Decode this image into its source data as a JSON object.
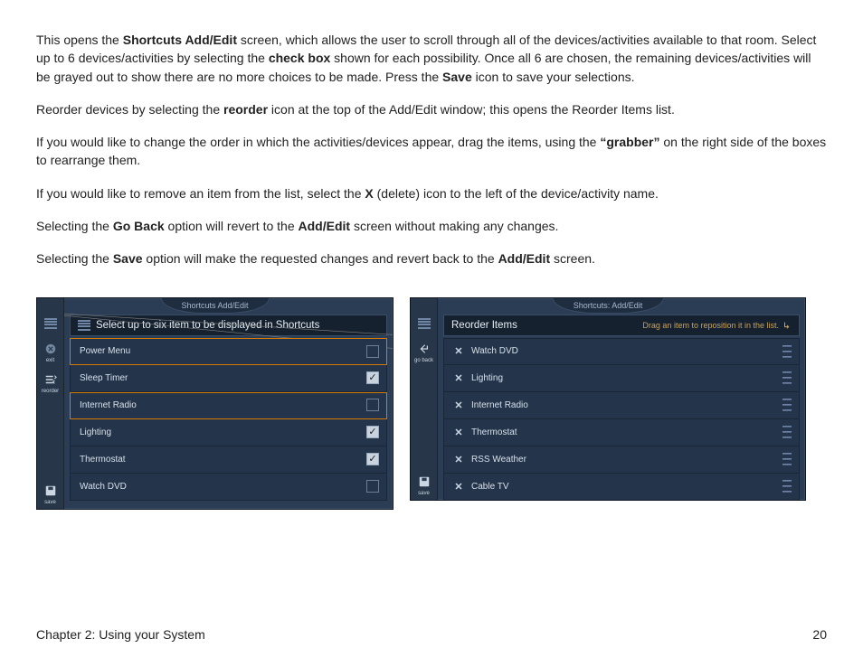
{
  "paragraphs": {
    "p1a": "This opens the ",
    "p1b": "Shortcuts Add/Edit",
    "p1c": " screen, which allows the user to scroll through all of the devices/activities available to that room. Select up to 6 devices/activities by selecting the ",
    "p1d": "check box",
    "p1e": " shown for each possibility. Once all 6 are chosen, the remaining devices/activities will be grayed out to show there are no more choices to be made. Press the ",
    "p1f": "Save",
    "p1g": " icon to save your selections.",
    "p2a": "Reorder devices by selecting the ",
    "p2b": "reorder",
    "p2c": " icon at the top of the Add/Edit window; this opens the Reorder Items list.",
    "p3a": "If you would like to change the order in which the activities/devices appear, drag the items, using the ",
    "p3b": "“grabber”",
    "p3c": " on the right side of the boxes to rearrange them.",
    "p4a": "If you would like to remove an item from the list, select the ",
    "p4b": "X",
    "p4c": " (delete) icon to the left of the device/activity name.",
    "p5a": "Selecting the ",
    "p5b": "Go Back",
    "p5c": " option will revert to the ",
    "p5d": "Add/Edit",
    "p5e": " screen without making any changes.",
    "p6a": "Selecting the ",
    "p6b": "Save",
    "p6c": " option will make the requested changes and revert back to the ",
    "p6d": "Add/Edit",
    "p6e": " screen."
  },
  "left_panel": {
    "title": "Shortcuts Add/Edit",
    "header": "Select up to six item to be displayed in Shortcuts",
    "sidebar": {
      "exit": "exit",
      "reorder": "reorder",
      "save": "save"
    },
    "items": [
      {
        "label": "Power Menu",
        "checked": false,
        "selected": true
      },
      {
        "label": "Sleep Timer",
        "checked": true,
        "selected": false
      },
      {
        "label": "Internet Radio",
        "checked": false,
        "selected": true
      },
      {
        "label": "Lighting",
        "checked": true,
        "selected": false
      },
      {
        "label": "Thermostat",
        "checked": true,
        "selected": false
      },
      {
        "label": "Watch DVD",
        "checked": false,
        "selected": false
      }
    ]
  },
  "right_panel": {
    "title": "Shortcuts: Add/Edit",
    "header": "Reorder Items",
    "hint": "Drag an item to reposition it in the list.",
    "sidebar": {
      "goback": "go back",
      "save": "save"
    },
    "items": [
      {
        "label": "Watch DVD"
      },
      {
        "label": "Lighting"
      },
      {
        "label": "Internet Radio"
      },
      {
        "label": "Thermostat"
      },
      {
        "label": "RSS Weather"
      },
      {
        "label": "Cable TV"
      }
    ]
  },
  "footer": {
    "chapter": "Chapter 2: Using your System",
    "page": "20"
  }
}
